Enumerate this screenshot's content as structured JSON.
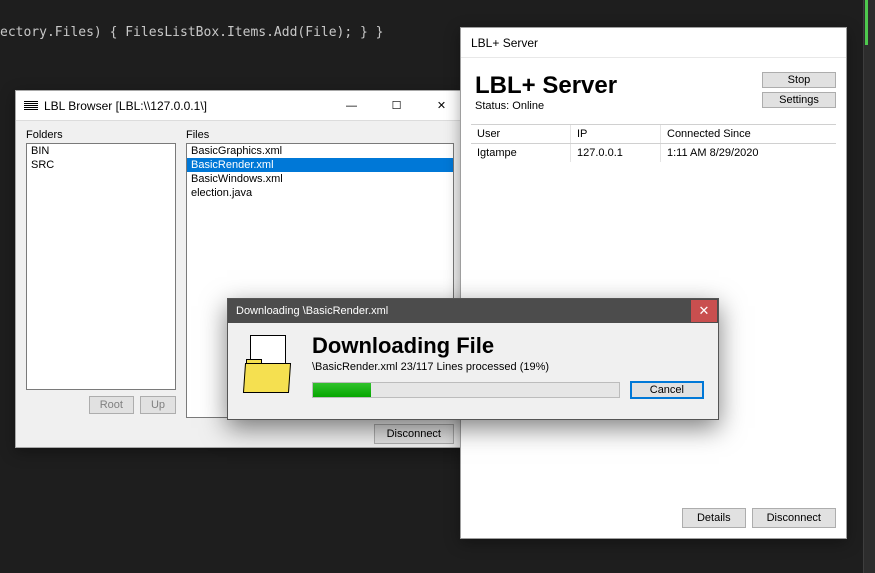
{
  "code_line": "ectory.Files) { FilesListBox.Items.Add(File); } }",
  "browser": {
    "title": "LBL Browser [LBL:\\\\127.0.0.1\\]",
    "folders_label": "Folders",
    "files_label": "Files",
    "folders": [
      "BIN",
      "SRC"
    ],
    "files": [
      "BasicGraphics.xml",
      "BasicRender.xml",
      "BasicWindows.xml",
      "election.java"
    ],
    "selected_file_index": 1,
    "root_btn": "Root",
    "up_btn": "Up",
    "disconnect_btn": "Disconnect"
  },
  "server": {
    "window_title": "LBL+ Server",
    "heading": "LBL+ Server",
    "status": "Status: Online",
    "stop_btn": "Stop",
    "settings_btn": "Settings",
    "columns": {
      "user": "User",
      "ip": "IP",
      "conn": "Connected Since"
    },
    "rows": [
      {
        "user": "Igtampe",
        "ip": "127.0.0.1",
        "conn": "1:11 AM 8/29/2020"
      }
    ],
    "details_btn": "Details",
    "disconnect_btn": "Disconnect"
  },
  "download": {
    "title": "Downloading \\BasicRender.xml",
    "heading": "Downloading File",
    "info": "\\BasicRender.xml 23/117 Lines processed (19%)",
    "progress_percent": 19,
    "cancel_btn": "Cancel"
  }
}
